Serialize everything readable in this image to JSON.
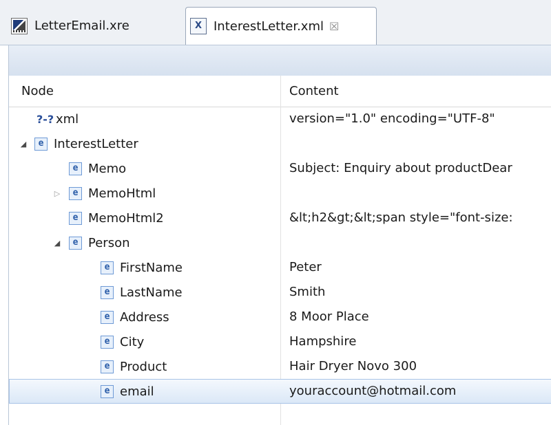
{
  "tabs": [
    {
      "label": "LetterEmail.xre",
      "icon": "report-file-icon",
      "active": false
    },
    {
      "label": "InterestLetter.xml",
      "icon": "xml-file-icon",
      "active": true,
      "close": "☒"
    }
  ],
  "table": {
    "columns": [
      "Node",
      "Content"
    ],
    "rows": [
      {
        "icon": "?-?",
        "label": "xml",
        "content": "version=\"1.0\" encoding=\"UTF-8\""
      },
      {
        "icon": "e",
        "label": "InterestLetter",
        "content": ""
      },
      {
        "icon": "e",
        "label": "Memo",
        "content": "Subject: Enquiry about productDear"
      },
      {
        "icon": "e",
        "label": "MemoHtml",
        "content": ""
      },
      {
        "icon": "e",
        "label": "MemoHtml2",
        "content": "&lt;h2&gt;&lt;span style=\"font-size:"
      },
      {
        "icon": "e",
        "label": "Person",
        "content": ""
      },
      {
        "icon": "e",
        "label": "FirstName",
        "content": "Peter"
      },
      {
        "icon": "e",
        "label": "LastName",
        "content": "Smith"
      },
      {
        "icon": "e",
        "label": "Address",
        "content": "8 Moor Place"
      },
      {
        "icon": "e",
        "label": "City",
        "content": "Hampshire"
      },
      {
        "icon": "e",
        "label": "Product",
        "content": "Hair Dryer Novo 300"
      },
      {
        "icon": "e",
        "label": "email",
        "content": "youraccount@hotmail.com",
        "selected": true
      }
    ]
  },
  "colors": {
    "selection": "#dbe8f7",
    "element_icon": "#2a5ca8",
    "toolbar": "#d6e1ef"
  }
}
